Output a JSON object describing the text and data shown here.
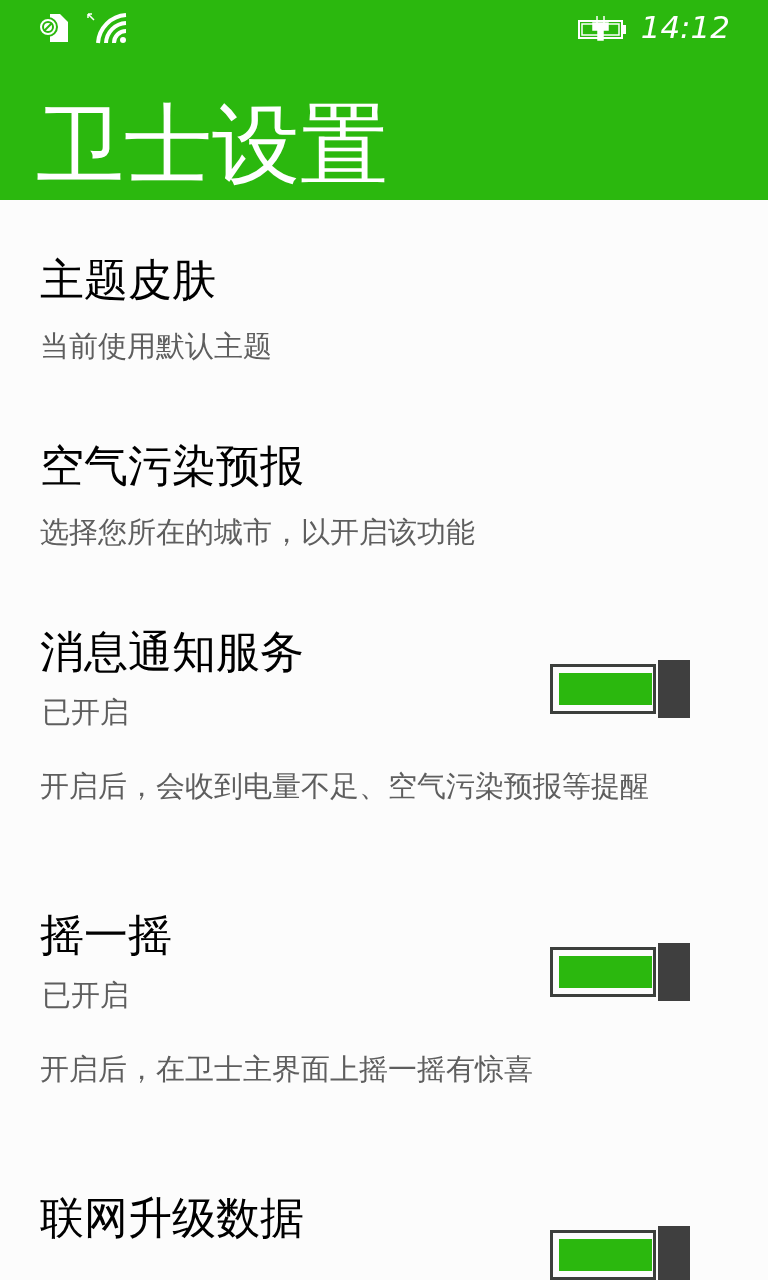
{
  "status_bar": {
    "time": "14:12"
  },
  "header": {
    "title": "卫士设置"
  },
  "settings": [
    {
      "kind": "link",
      "title": "主题皮肤",
      "subtitle": "当前使用默认主题"
    },
    {
      "kind": "link",
      "title": "空气污染预报",
      "subtitle": "选择您所在的城市，以开启该功能"
    },
    {
      "kind": "toggle",
      "title": "消息通知服务",
      "on": true,
      "state_label": "已开启",
      "description": "开启后，会收到电量不足、空气污染预报等提醒"
    },
    {
      "kind": "toggle",
      "title": "摇一摇",
      "on": true,
      "state_label": "已开启",
      "description": "开启后，在卫士主界面上摇一摇有惊喜"
    },
    {
      "kind": "toggle",
      "title": "联网升级数据",
      "on": true
    }
  ]
}
